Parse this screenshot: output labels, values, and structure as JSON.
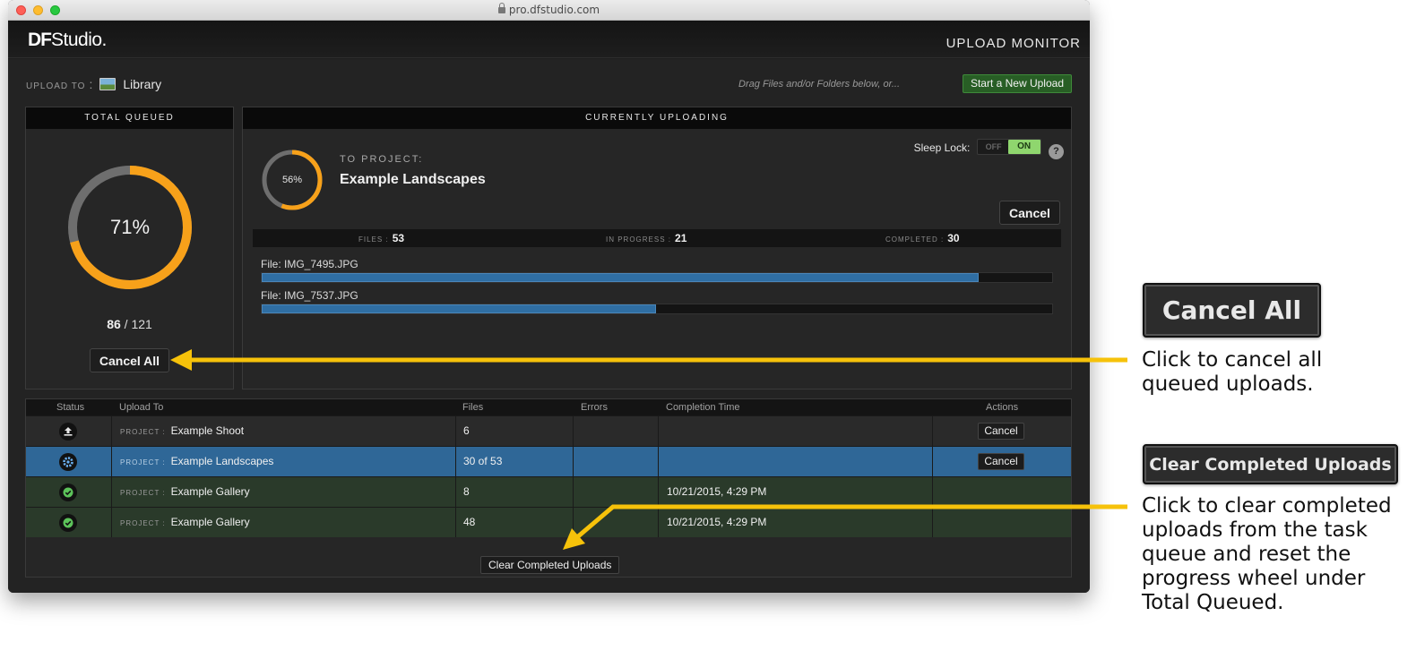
{
  "browser": {
    "url": "pro.dfstudio.com"
  },
  "app": {
    "logo_df": "DF",
    "logo_studio": "Studio",
    "logo_dot": ".",
    "title": "UPLOAD MONITOR"
  },
  "upload_to": {
    "label": "UPLOAD TO",
    "colon": ":",
    "destination": "Library"
  },
  "drag_hint": "Drag Files and/or Folders below, or...",
  "start_button": "Start a New Upload",
  "total_queued": {
    "header": "TOTAL QUEUED",
    "percent": 71,
    "percent_label": "71%",
    "completed": "86",
    "separator": "/",
    "total": "121",
    "cancel_all_label": "Cancel All"
  },
  "current": {
    "header": "CURRENTLY UPLOADING",
    "percent": 56,
    "percent_label": "56%",
    "to_project_label": "TO PROJECT:",
    "project_name": "Example Landscapes",
    "sleep_lock_label": "Sleep Lock:",
    "toggle_off": "OFF",
    "toggle_on": "ON",
    "help": "?",
    "cancel_label": "Cancel",
    "stats": {
      "files_label": "FILES :",
      "files": "53",
      "in_progress_label": "IN PROGRESS :",
      "in_progress": "21",
      "completed_label": "COMPLETED :",
      "completed": "30"
    },
    "files": [
      {
        "label": "File: IMG_7495.JPG",
        "progress": 0.907
      },
      {
        "label": "File: IMG_7537.JPG",
        "progress": 0.499
      }
    ]
  },
  "table": {
    "headers": {
      "status": "Status",
      "upload_to": "Upload To",
      "files": "Files",
      "errors": "Errors",
      "completion": "Completion Time",
      "actions": "Actions"
    },
    "project_key": "PROJECT :",
    "rows": [
      {
        "status": "upload-icon",
        "project": "Example Shoot",
        "files": "6",
        "errors": "",
        "completion": "",
        "action": "Cancel",
        "state": "queued"
      },
      {
        "status": "gear-icon",
        "project": "Example Landscapes",
        "files": "30 of 53",
        "errors": "",
        "completion": "",
        "action": "Cancel",
        "state": "active"
      },
      {
        "status": "check-icon",
        "project": "Example Gallery",
        "files": "8",
        "errors": "",
        "completion": "10/21/2015, 4:29 PM",
        "action": "",
        "state": "done"
      },
      {
        "status": "check-icon",
        "project": "Example Gallery",
        "files": "48",
        "errors": "",
        "completion": "10/21/2015, 4:29 PM",
        "action": "",
        "state": "done"
      }
    ],
    "clear_label": "Clear Completed Uploads"
  },
  "callouts": {
    "cancel_all_button": "Cancel All",
    "cancel_all_line1": "Click to cancel all",
    "cancel_all_line2": "queued uploads.",
    "clear_button": "Clear Completed Uploads",
    "clear_line1": "Click to clear completed",
    "clear_line2": "uploads from the task",
    "clear_line3": "queue and reset the",
    "clear_line4": "progress wheel under",
    "clear_line5": "Total Queued."
  },
  "colors": {
    "accent_orange": "#f7a11a",
    "ring_track": "#6e6e6e",
    "progress_blue": "#2f6ea3",
    "arrow_yellow": "#f6c20a",
    "done_check": "#5cc35a"
  }
}
